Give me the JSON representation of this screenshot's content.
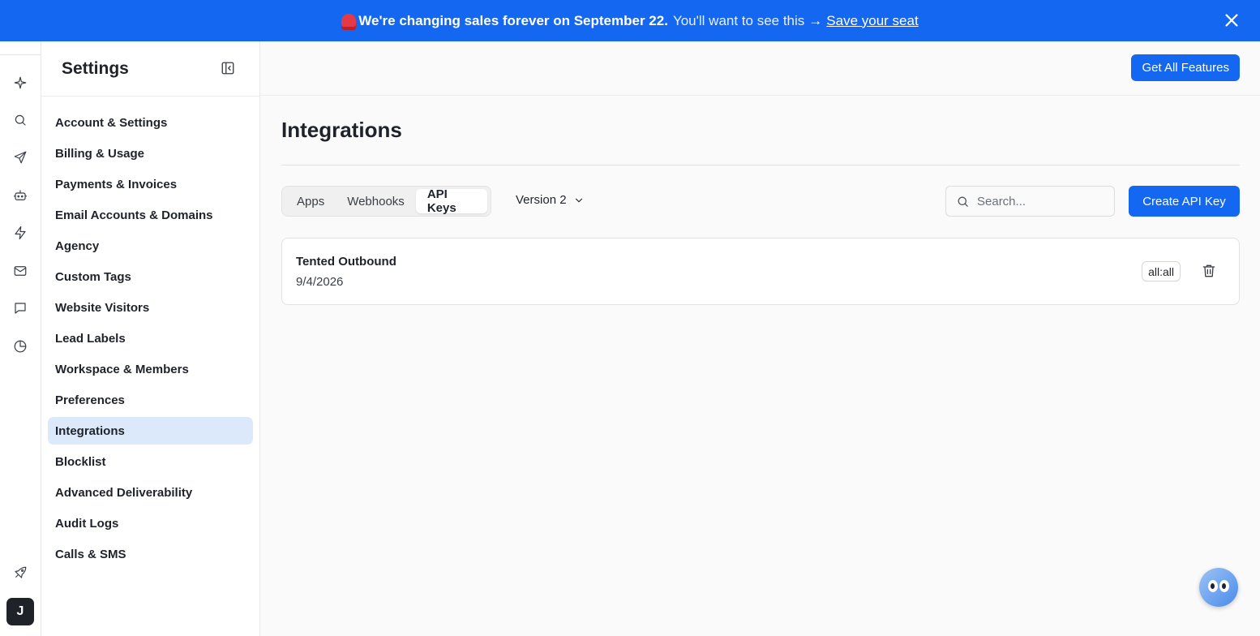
{
  "banner": {
    "headline": "We're changing sales forever on September 22.",
    "subtext": "You'll want to see this",
    "arrow": "→",
    "link": "Save your seat",
    "bg_color": "#1467f0"
  },
  "rail": {
    "icons": [
      "sparkle-icon",
      "search-icon",
      "send-icon",
      "bot-icon",
      "lightning-icon",
      "mail-icon",
      "chat-icon",
      "pie-chart-icon",
      "rocket-icon"
    ],
    "avatar_initial": "J"
  },
  "sidebar": {
    "title": "Settings",
    "items": [
      {
        "label": "Account & Settings"
      },
      {
        "label": "Billing & Usage"
      },
      {
        "label": "Payments & Invoices"
      },
      {
        "label": "Email Accounts & Domains"
      },
      {
        "label": "Agency"
      },
      {
        "label": "Custom Tags"
      },
      {
        "label": "Website Visitors"
      },
      {
        "label": "Lead Labels"
      },
      {
        "label": "Workspace & Members"
      },
      {
        "label": "Preferences"
      },
      {
        "label": "Integrations"
      },
      {
        "label": "Blocklist"
      },
      {
        "label": "Advanced Deliverability"
      },
      {
        "label": "Audit Logs"
      },
      {
        "label": "Calls & SMS"
      }
    ],
    "active_index": 10
  },
  "topbar": {
    "get_all_label": "Get All Features"
  },
  "main": {
    "title": "Integrations",
    "tabs": [
      {
        "label": "Apps"
      },
      {
        "label": "Webhooks"
      },
      {
        "label": "API Keys"
      }
    ],
    "active_tab": 2,
    "version_label": "Version 2",
    "search_placeholder": "Search...",
    "create_label": "Create API Key",
    "api_keys": [
      {
        "name": "Tented Outbound",
        "date": "9/4/2026",
        "scope": "all:all"
      }
    ]
  },
  "colors": {
    "accent": "#1467f0",
    "active_nav_bg": "#dbe9fb"
  }
}
